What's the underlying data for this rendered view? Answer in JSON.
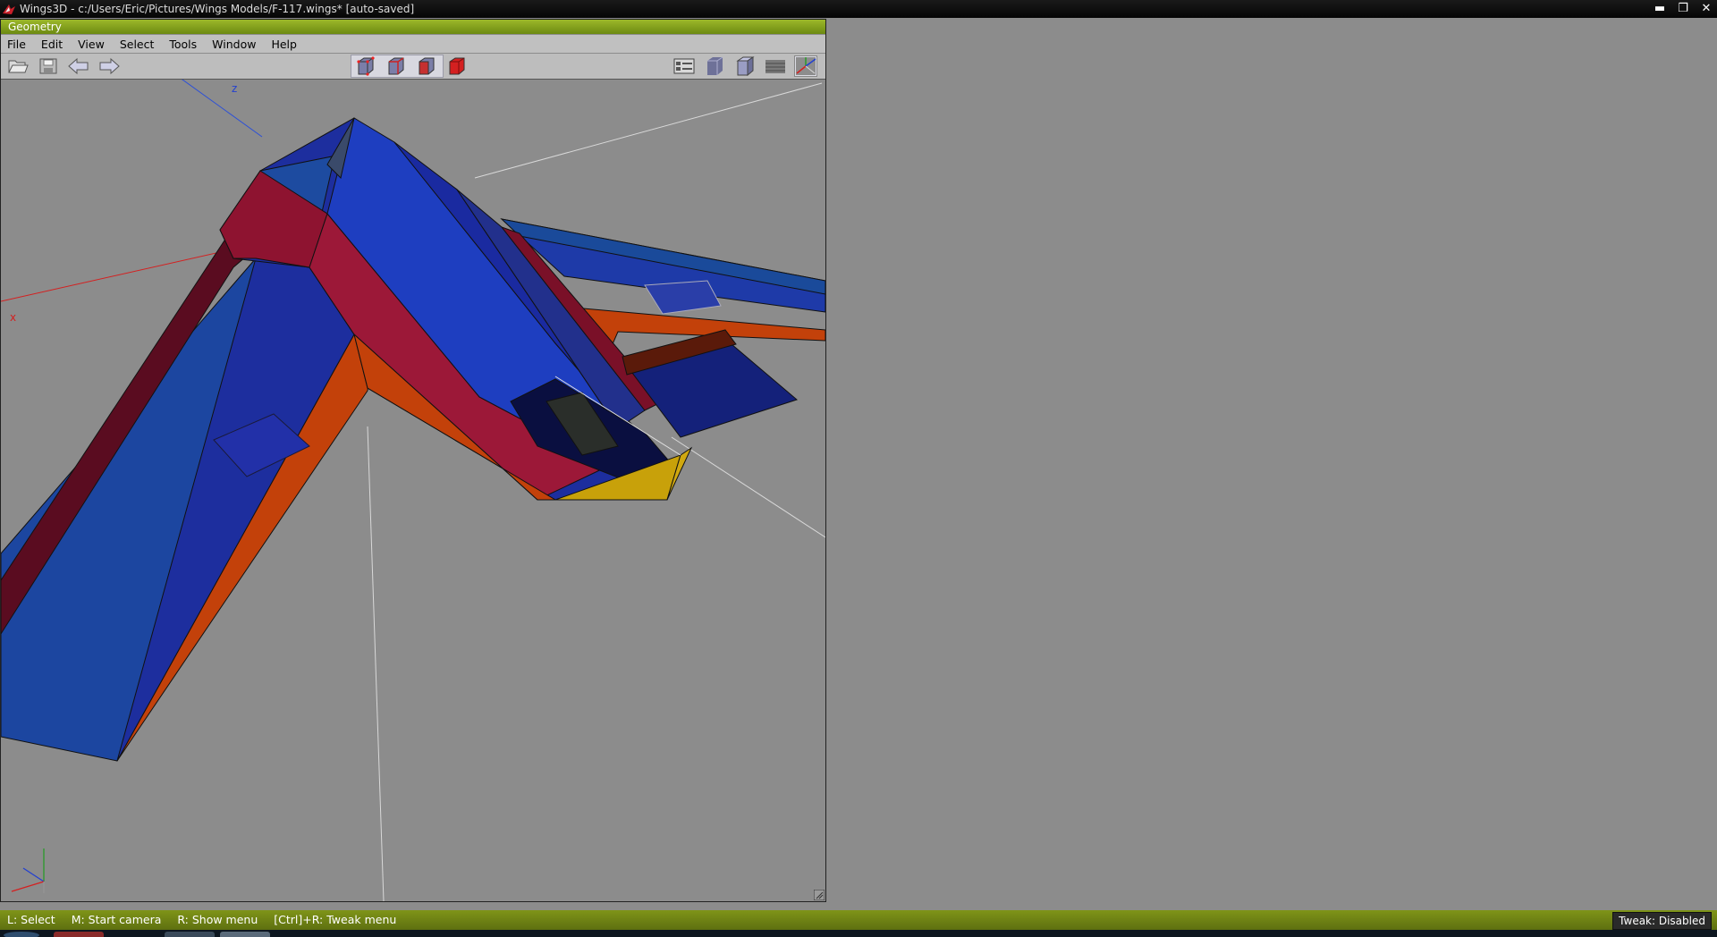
{
  "window": {
    "title": "Wings3D - c:/Users/Eric/Pictures/Wings Models/F-117.wings* [auto-saved]",
    "controls": [
      "minimize-icon",
      "restore-icon",
      "close-icon"
    ]
  },
  "geometry": {
    "title": "Geometry",
    "menu": [
      "File",
      "Edit",
      "View",
      "Select",
      "Tools",
      "Window",
      "Help"
    ],
    "toolbar_left": [
      "open-icon",
      "save-icon",
      "undo-icon",
      "redo-icon"
    ],
    "selection_modes": [
      "vertex-mode-icon",
      "edge-mode-icon",
      "face-mode-icon",
      "body-mode-icon"
    ],
    "active_selection_mode": "body-mode-icon",
    "view_buttons": [
      "outliner-icon",
      "smooth-shade-icon",
      "flat-shade-icon",
      "ground-plane-icon",
      "axes-icon"
    ],
    "axis_labels": {
      "x": "x",
      "z": "z"
    }
  },
  "status": {
    "hints": [
      "L: Select",
      "M: Start camera",
      "R: Show menu",
      "[Ctrl]+R: Tweak menu"
    ],
    "tweak": "Tweak: Disabled"
  },
  "colors": {
    "title_green": "#7f9a1c",
    "model_blue": "#1c2fa8",
    "model_red": "#8e1330",
    "model_orange": "#c3410a",
    "model_yellow": "#c8a10a",
    "background": "#8c8c8c"
  }
}
